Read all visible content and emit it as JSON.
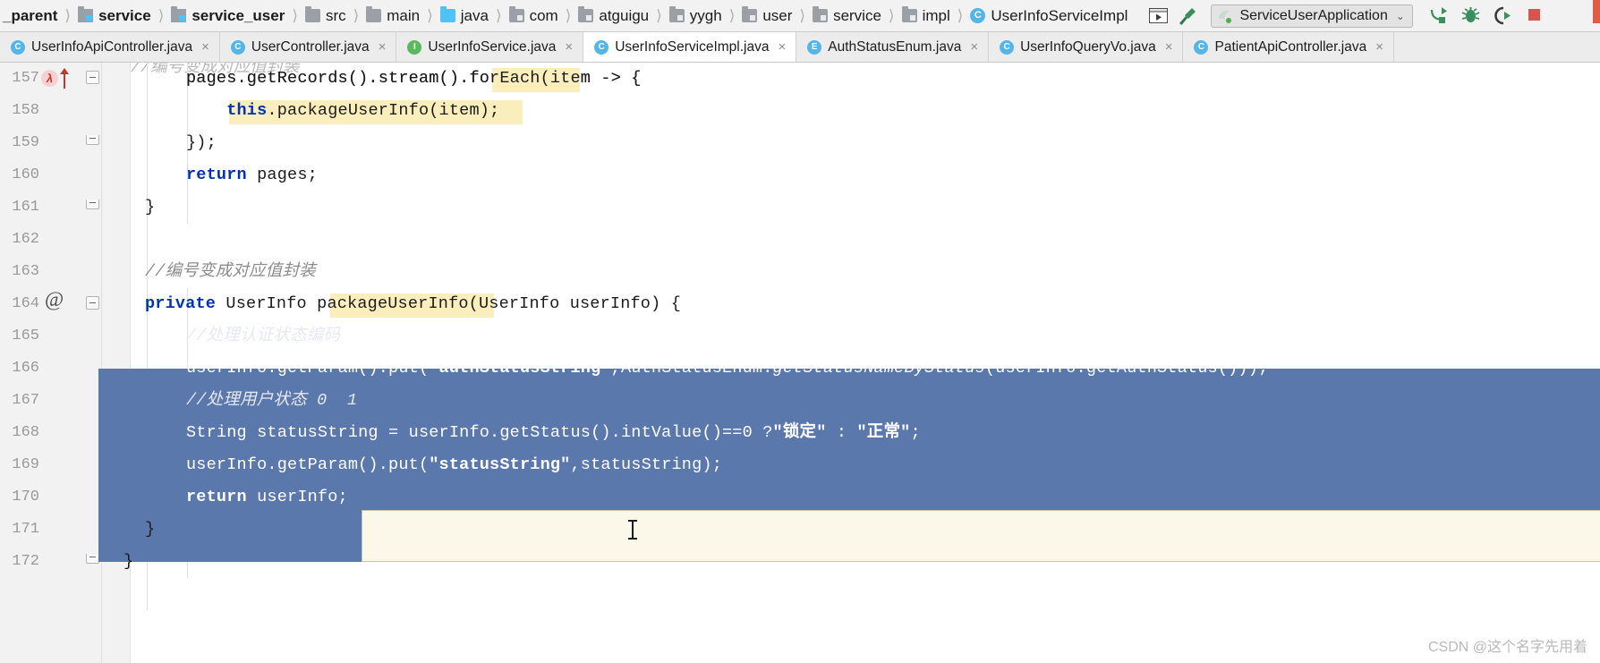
{
  "navbar": {
    "breadcrumbs": [
      {
        "label": "_parent",
        "icon": "none",
        "bold": true
      },
      {
        "label": "service",
        "icon": "module-icon",
        "bold": true
      },
      {
        "label": "service_user",
        "icon": "module-icon",
        "bold": true
      },
      {
        "label": "src",
        "icon": "folder-icon",
        "bold": false
      },
      {
        "label": "main",
        "icon": "folder-icon",
        "bold": false
      },
      {
        "label": "java",
        "icon": "source-folder-icon",
        "bold": false
      },
      {
        "label": "com",
        "icon": "package-icon",
        "bold": false
      },
      {
        "label": "atguigu",
        "icon": "package-icon",
        "bold": false
      },
      {
        "label": "yygh",
        "icon": "package-icon",
        "bold": false
      },
      {
        "label": "user",
        "icon": "package-icon",
        "bold": false
      },
      {
        "label": "service",
        "icon": "package-icon",
        "bold": false
      },
      {
        "label": "impl",
        "icon": "package-icon",
        "bold": false
      },
      {
        "label": "UserInfoServiceImpl",
        "icon": "java-class-icon",
        "bold": false
      }
    ],
    "separator": "〉",
    "tools": [
      {
        "name": "open-in-window-icon",
        "glyph": "▶"
      },
      {
        "name": "hammer-build-icon",
        "glyph": "⚒"
      }
    ],
    "run_config": {
      "name": "ServiceUserApplication",
      "icon": "spring-boot-icon",
      "chevron": "⌄"
    },
    "run_icons": [
      {
        "name": "run-icon",
        "label": "Run"
      },
      {
        "name": "debug-icon",
        "label": "Debug"
      },
      {
        "name": "run-with-coverage-icon",
        "label": "Run with Coverage"
      },
      {
        "name": "stop-icon",
        "label": "Stop"
      }
    ]
  },
  "tabs": [
    {
      "label": "UserInfoApiController.java",
      "icon": "java-class-icon",
      "kind": "c",
      "active": false,
      "close": "×"
    },
    {
      "label": "UserController.java",
      "icon": "java-class-icon",
      "kind": "c",
      "active": false,
      "close": "×"
    },
    {
      "label": "UserInfoService.java",
      "icon": "java-interface-icon",
      "kind": "i",
      "active": false,
      "close": "×"
    },
    {
      "label": "UserInfoServiceImpl.java",
      "icon": "java-class-icon",
      "kind": "c",
      "active": true,
      "close": "×"
    },
    {
      "label": "AuthStatusEnum.java",
      "icon": "java-enum-icon",
      "kind": "e",
      "active": false,
      "close": "×"
    },
    {
      "label": "UserInfoQueryVo.java",
      "icon": "java-class-icon",
      "kind": "c",
      "active": false,
      "close": "×"
    },
    {
      "label": "PatientApiController.java",
      "icon": "java-class-icon",
      "kind": "c",
      "active": false,
      "close": "×"
    }
  ],
  "editor": {
    "clipped_top_comment": "//编号变成对应值封装",
    "lines": [
      {
        "num": "157",
        "indent": 3,
        "gutter": "lambda-marker",
        "fold": "top",
        "code": "pages.getRecords().stream().forEach(item -> {",
        "hl_word": "forEach"
      },
      {
        "num": "158",
        "indent": 4,
        "gutter": "",
        "fold": "",
        "code": "this.packageUserInfo(item);",
        "hl_word": "this.packageUserInfo(item)"
      },
      {
        "num": "159",
        "indent": 3,
        "gutter": "",
        "fold": "bottom",
        "code": "});",
        "hl_word": ""
      },
      {
        "num": "160",
        "indent": 3,
        "gutter": "",
        "fold": "",
        "code": "return pages;",
        "hl_word": ""
      },
      {
        "num": "161",
        "indent": 2,
        "gutter": "",
        "fold": "bottom",
        "code": "}",
        "hl_word": ""
      },
      {
        "num": "162",
        "indent": 0,
        "gutter": "",
        "fold": "",
        "code": "",
        "hl_word": ""
      },
      {
        "num": "163",
        "indent": 2,
        "gutter": "",
        "fold": "",
        "code": "//编号变成对应值封装",
        "hl_word": ""
      },
      {
        "num": "164",
        "indent": 2,
        "gutter": "at-annotation",
        "fold": "top",
        "code": "private UserInfo packageUserInfo(UserInfo userInfo) {",
        "hl_word": "packageUserInfo"
      },
      {
        "num": "165",
        "indent": 3,
        "gutter": "",
        "fold": "",
        "code": "//处理认证状态编码",
        "hl_word": ""
      },
      {
        "num": "166",
        "indent": 3,
        "gutter": "",
        "fold": "",
        "code": "userInfo.getParam().put(\"authStatusString\",AuthStatusEnum.getStatusNameByStatus(userInfo.getAuthStatus()));",
        "hl_word": ""
      },
      {
        "num": "167",
        "indent": 3,
        "gutter": "",
        "fold": "",
        "code": "//处理用户状态 0  1",
        "hl_word": ""
      },
      {
        "num": "168",
        "indent": 3,
        "gutter": "",
        "fold": "",
        "code": "String statusString = userInfo.getStatus().intValue()==0 ?\"锁定\" : \"正常\";",
        "hl_word": ""
      },
      {
        "num": "169",
        "indent": 3,
        "gutter": "",
        "fold": "",
        "code": "userInfo.getParam().put(\"statusString\",statusString);",
        "hl_word": ""
      },
      {
        "num": "170",
        "indent": 3,
        "gutter": "bookmark-dot",
        "fold": "",
        "code": "return userInfo;",
        "hl_word": ""
      },
      {
        "num": "171",
        "indent": 2,
        "gutter": "",
        "fold": "bottom",
        "code": "}",
        "hl_word": ""
      },
      {
        "num": "172",
        "indent": 1,
        "gutter": "",
        "fold": "",
        "code": "}",
        "hl_word": ""
      }
    ],
    "selection": {
      "start_line": "165",
      "end_line": "170",
      "color": "#5b78ad"
    },
    "colors": {
      "keyword": "#0033b3",
      "string": "#067d17",
      "comment": "#8c8c8c",
      "occurrence_highlight": "#fbeebd",
      "selection": "#5b78ad",
      "current_line": "#fdf6e3",
      "gutter_bg": "#f2f2f2",
      "line_number": "#999999"
    }
  },
  "watermark": "CSDN @这个名字先用着"
}
